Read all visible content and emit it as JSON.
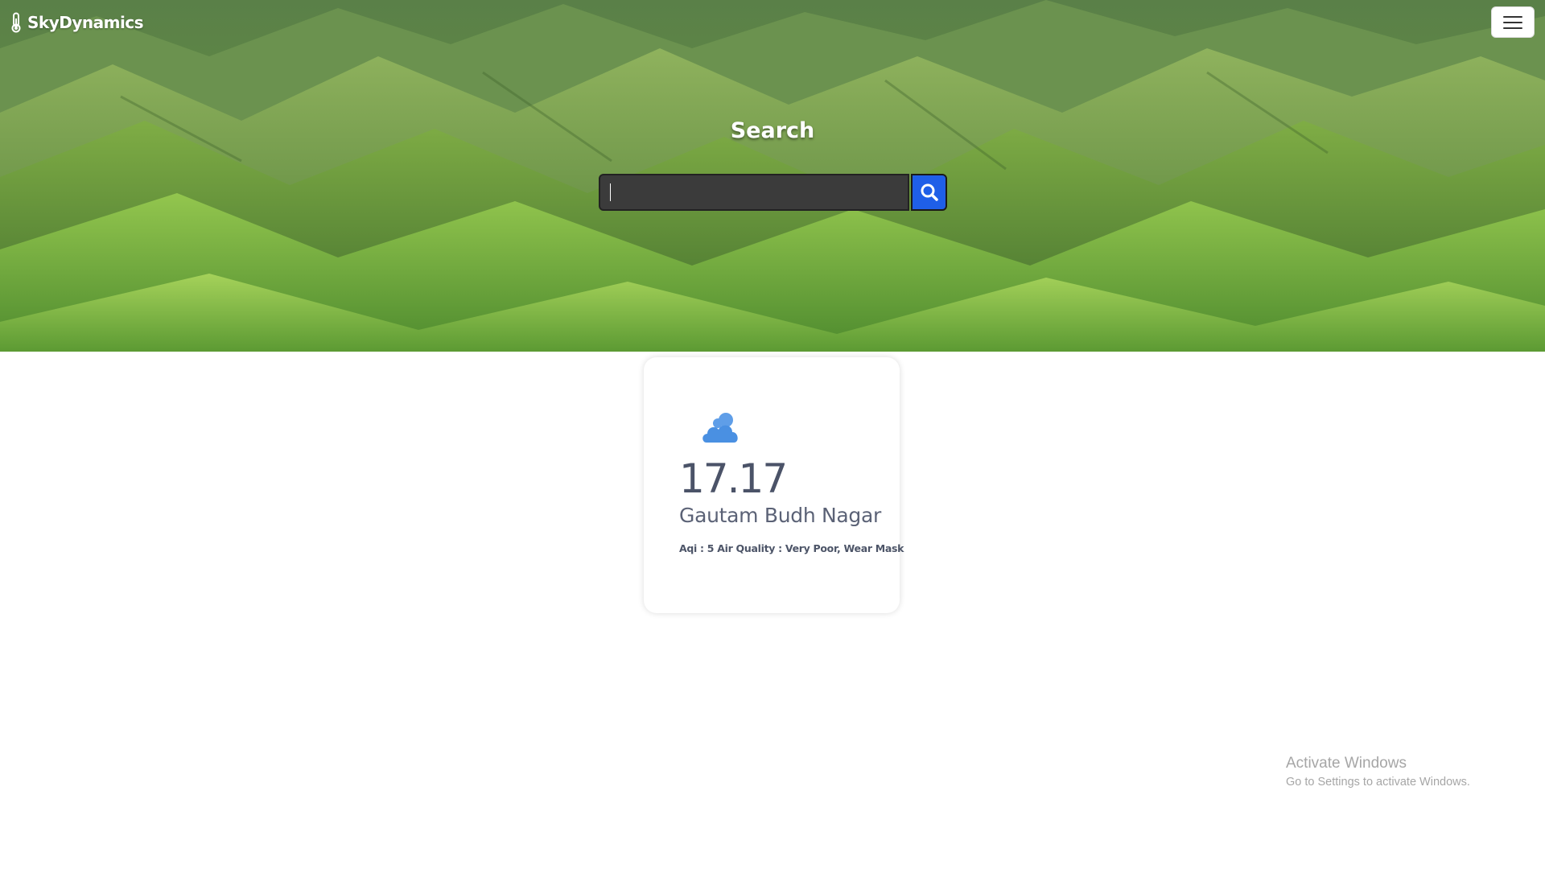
{
  "navbar": {
    "brand": "SkyDynamics",
    "brand_icon": "thermometer-icon",
    "menu_icon": "hamburger-icon"
  },
  "hero": {
    "title": "Search",
    "search_input": {
      "value": "",
      "placeholder": ""
    },
    "search_button_icon": "search-icon"
  },
  "weather_card": {
    "icon": "cloud-icon",
    "temperature": "17.17",
    "city": "Gautam Budh Nagar",
    "aqi_text": "Aqi : 5 Air Quality : Very Poor, Wear Mask"
  },
  "os_overlay": {
    "title": "Activate Windows",
    "subtitle": "Go to Settings to activate Windows."
  },
  "colors": {
    "search_button": "#1f5fe8",
    "weather_icon": "#4a90e2",
    "card_text": "#4b5368"
  }
}
